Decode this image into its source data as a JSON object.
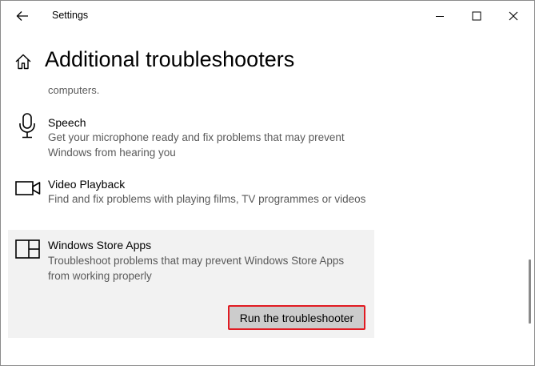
{
  "window": {
    "app_title": "Settings",
    "controls": {
      "minimize": "minimize-icon",
      "maximize": "maximize-icon",
      "close": "close-icon"
    }
  },
  "page": {
    "title": "Additional troubleshooters",
    "clipped_previous_desc": "computers."
  },
  "items": [
    {
      "name": "Speech",
      "icon": "microphone-icon",
      "desc": "Get your microphone ready and fix problems that may prevent Windows from hearing you"
    },
    {
      "name": "Video Playback",
      "icon": "video-camera-icon",
      "desc": "Find and fix problems with playing films, TV programmes or videos"
    },
    {
      "name": "Windows Store Apps",
      "icon": "store-apps-icon",
      "desc": "Troubleshoot problems that may prevent Windows Store Apps from working properly",
      "button": "Run the troubleshooter"
    }
  ],
  "colors": {
    "highlight_border": "#e11b22",
    "selected_bg": "#f2f2f2",
    "button_bg": "#cccccc"
  }
}
